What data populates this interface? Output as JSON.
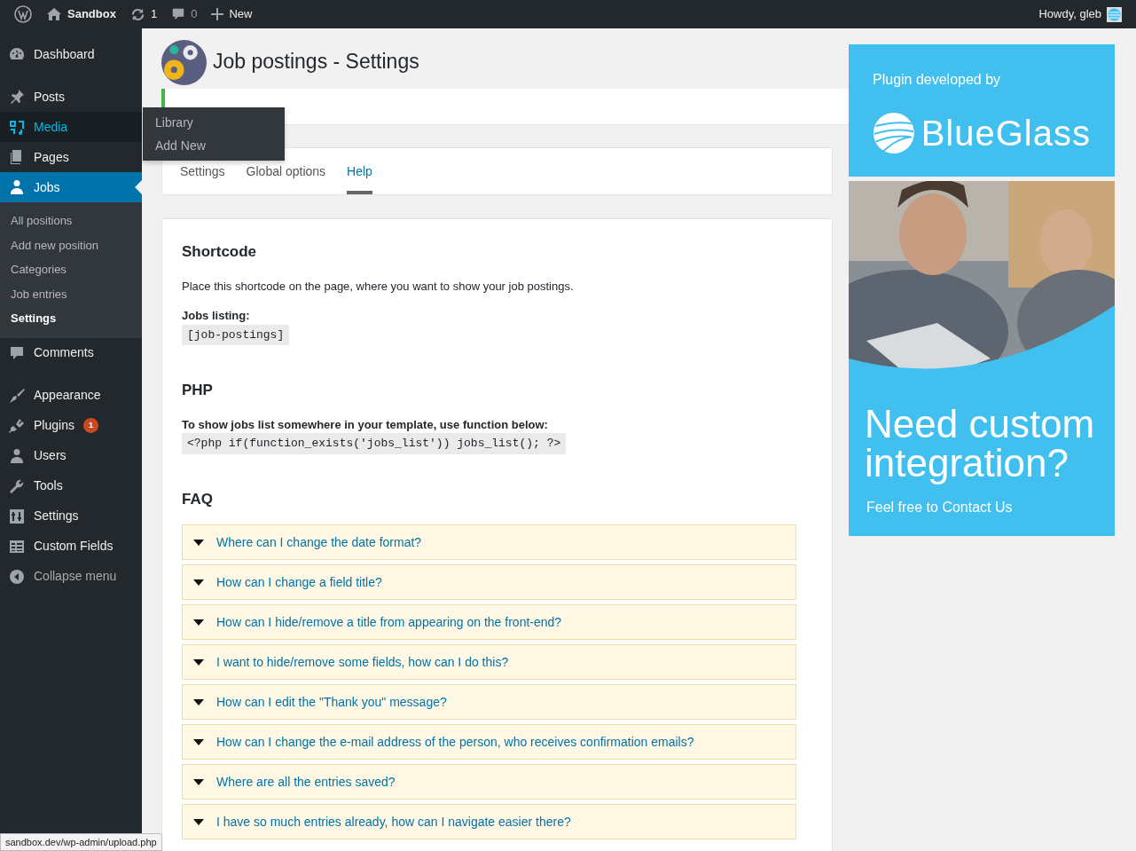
{
  "admin_bar": {
    "site": "Sandbox",
    "updates": "1",
    "comments": "0",
    "new_label": "New",
    "greeting": "Howdy, gleb"
  },
  "sidebar": {
    "groups": [
      [
        {
          "label": "Dashboard",
          "selected": false,
          "hovered": false
        }
      ],
      [
        {
          "label": "Posts",
          "selected": false,
          "hovered": false
        },
        {
          "label": "Media",
          "selected": false,
          "hovered": true
        },
        {
          "label": "Pages",
          "selected": false,
          "hovered": false
        },
        {
          "label": "Jobs",
          "selected": true,
          "hovered": false,
          "children": [
            {
              "label": "All positions",
              "selected": false
            },
            {
              "label": "Add new position",
              "selected": false
            },
            {
              "label": "Categories",
              "selected": false
            },
            {
              "label": "Job entries",
              "selected": false
            },
            {
              "label": "Settings",
              "selected": true
            }
          ]
        },
        {
          "label": "Comments",
          "selected": false,
          "hovered": false
        }
      ],
      [
        {
          "label": "Appearance",
          "selected": false,
          "hovered": false
        },
        {
          "label": "Plugins",
          "selected": false,
          "hovered": false,
          "badge": "1"
        },
        {
          "label": "Users",
          "selected": false,
          "hovered": false
        },
        {
          "label": "Tools",
          "selected": false,
          "hovered": false
        },
        {
          "label": "Settings",
          "selected": false,
          "hovered": false
        },
        {
          "label": "Custom Fields",
          "selected": false,
          "hovered": false
        }
      ]
    ],
    "collapse": "Collapse menu",
    "flyout": [
      "Library",
      "Add New"
    ]
  },
  "page": {
    "title": "Job postings - Settings",
    "tabs": [
      {
        "label": "Settings",
        "selected": false
      },
      {
        "label": "Global options",
        "selected": false
      },
      {
        "label": "Help",
        "selected": true
      }
    ],
    "shortcode": {
      "heading": "Shortcode",
      "text": "Place this shortcode on the page, where you want to show your job postings.",
      "label": "Jobs listing:",
      "code": "[job-postings]"
    },
    "php": {
      "heading": "PHP",
      "label": "To show jobs list somewhere in your template, use function below:",
      "code": "<?php if(function_exists('jobs_list')) jobs_list(); ?>"
    },
    "faq": {
      "heading": "FAQ",
      "items": [
        {
          "question": "Where can I change the date format?"
        },
        {
          "question": "How can I change a field title?"
        },
        {
          "question": "How can I hide/remove a title from appearing on the front-end?"
        },
        {
          "question": "I want to hide/remove some fields, how can I do this?"
        },
        {
          "question": "How can I edit the \"Thank you\" message?"
        },
        {
          "question": "How can I change the e-mail address of the person, who receives confirmation emails?"
        },
        {
          "question": "Where are all the entries saved?"
        },
        {
          "question": "I have so much entries already, how can I navigate easier there?"
        }
      ]
    }
  },
  "ad": {
    "label": "Plugin developed by",
    "brand": "BlueGlass",
    "headline": "Need custom integration?",
    "link": "Feel free to Contact Us"
  },
  "status_url": "sandbox.dev/wp-admin/upload.php"
}
